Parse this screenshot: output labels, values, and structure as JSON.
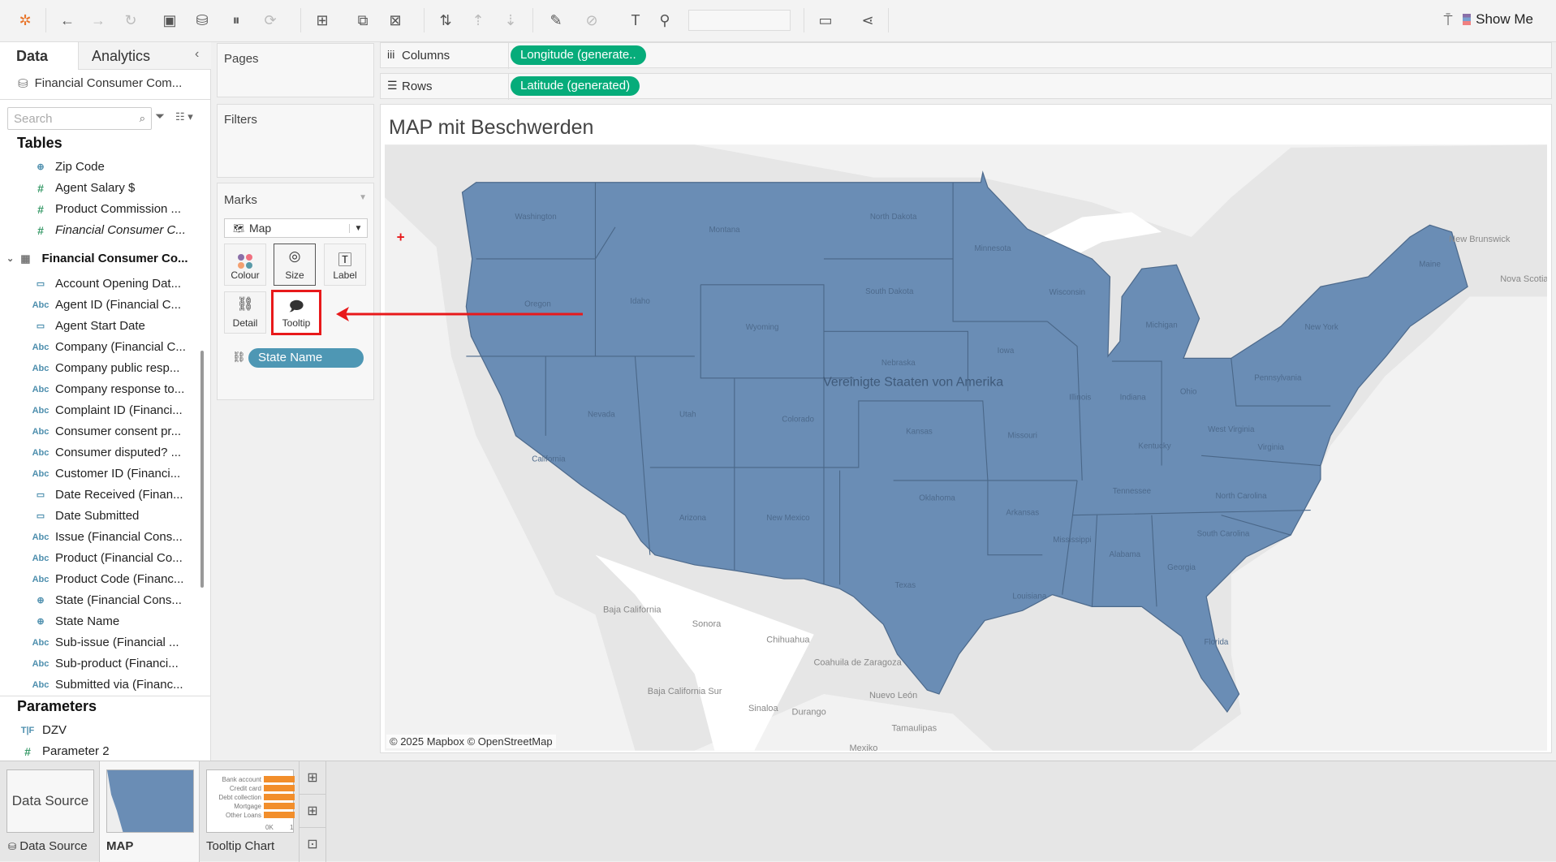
{
  "toolbar": {
    "icons": [
      "tableau-logo-icon",
      "undo-icon",
      "redo-icon",
      "replay-icon",
      "save-icon",
      "new-datasource-icon",
      "pause-updates-icon",
      "refresh-icon",
      "new-sheet-icon",
      "duplicate-sheet-icon",
      "clear-sheet-icon",
      "swap-icon",
      "sort-asc-icon",
      "sort-desc-icon",
      "highlight-icon",
      "group-icon",
      "label-toggle-icon",
      "pin-icon",
      "fit-dropdown",
      "presentation-icon",
      "share-icon"
    ],
    "show_me": "Show Me"
  },
  "left_pane": {
    "tabs": [
      "Data",
      "Analytics"
    ],
    "datasource": "Financial Consumer Com...",
    "search_placeholder": "Search",
    "tables_header": "Tables",
    "top_fields": [
      {
        "type": "geo",
        "label": "Zip Code"
      },
      {
        "type": "measure",
        "label": "Agent Salary $"
      },
      {
        "type": "measure",
        "label": "Product Commission ..."
      },
      {
        "type": "measure",
        "label": "Financial Consumer C...",
        "italic": true
      }
    ],
    "table_name": "Financial Consumer Co...",
    "fields": [
      {
        "type": "date",
        "label": "Account Opening Dat..."
      },
      {
        "type": "abc",
        "label": "Agent ID (Financial C..."
      },
      {
        "type": "date",
        "label": "Agent Start Date"
      },
      {
        "type": "abc",
        "label": "Company (Financial C..."
      },
      {
        "type": "abc",
        "label": "Company public resp..."
      },
      {
        "type": "abc",
        "label": "Company response to..."
      },
      {
        "type": "abc",
        "label": "Complaint ID (Financi..."
      },
      {
        "type": "abc",
        "label": "Consumer consent pr..."
      },
      {
        "type": "abc",
        "label": "Consumer disputed? ..."
      },
      {
        "type": "abc",
        "label": "Customer ID (Financi..."
      },
      {
        "type": "date",
        "label": "Date Received (Finan..."
      },
      {
        "type": "date",
        "label": "Date Submitted"
      },
      {
        "type": "abc",
        "label": "Issue (Financial Cons..."
      },
      {
        "type": "abc",
        "label": "Product (Financial Co..."
      },
      {
        "type": "abc",
        "label": "Product Code (Financ..."
      },
      {
        "type": "geo",
        "label": "State (Financial Cons..."
      },
      {
        "type": "geo",
        "label": "State Name"
      },
      {
        "type": "abc",
        "label": "Sub-issue (Financial ..."
      },
      {
        "type": "abc",
        "label": "Sub-product (Financi..."
      },
      {
        "type": "abc",
        "label": "Submitted via (Financ..."
      }
    ],
    "parameters_header": "Parameters",
    "parameters": [
      {
        "type": "bool",
        "label": "DZV"
      },
      {
        "type": "measure",
        "label": "Parameter 2"
      }
    ]
  },
  "shelves": {
    "pages": "Pages",
    "filters": "Filters",
    "columns_label": "Columns",
    "columns_pill": "Longitude (generate..",
    "rows_label": "Rows",
    "rows_pill": "Latitude (generated)"
  },
  "marks": {
    "title": "Marks",
    "type": "Map",
    "buttons": [
      "Colour",
      "Size",
      "Label",
      "Detail",
      "Tooltip"
    ],
    "pill": "State Name"
  },
  "view": {
    "title": "MAP mit Beschwerden",
    "attribution": "© 2025 Mapbox © OpenStreetMap",
    "country_label": "Vereinigte Staaten von Amerika",
    "state_labels": [
      "Washington",
      "Oregon",
      "California",
      "Idaho",
      "Nevada",
      "Montana",
      "Wyoming",
      "Utah",
      "Arizona",
      "North Dakota",
      "South Dakota",
      "Nebraska",
      "Colorado",
      "New Mexico",
      "Kansas",
      "Oklahoma",
      "Texas",
      "Minnesota",
      "Iowa",
      "Missouri",
      "Arkansas",
      "Louisiana",
      "Wisconsin",
      "Illinois",
      "Michigan",
      "Indiana",
      "Ohio",
      "Kentucky",
      "Tennessee",
      "Mississippi",
      "Alabama",
      "Georgia",
      "Florida",
      "South Carolina",
      "North Carolina",
      "Virginia",
      "West Virginia",
      "Pennsylvania",
      "New York",
      "Maine"
    ],
    "other_labels": [
      "Baja California",
      "Sonora",
      "Chihuahua",
      "Coahuila de Zaragoza",
      "Baja California Sur",
      "Sinaloa",
      "Durango",
      "Nuevo León",
      "Tamaulipas",
      "Mexiko",
      "New Brunswick",
      "Nova Scotia"
    ],
    "fill_color": "#6a8db5"
  },
  "bottom": {
    "datasource_tile": "Data Source",
    "datasource_tab": "Data Source",
    "sheets": [
      "MAP",
      "Tooltip Chart"
    ],
    "tooltip_chart_categories": [
      "Bank account",
      "Credit card",
      "Debt collection",
      "Mortgage",
      "Other Loans"
    ],
    "tooltip_chart_axis": [
      "0K",
      "1"
    ]
  },
  "annotation_color": "#e8191b"
}
